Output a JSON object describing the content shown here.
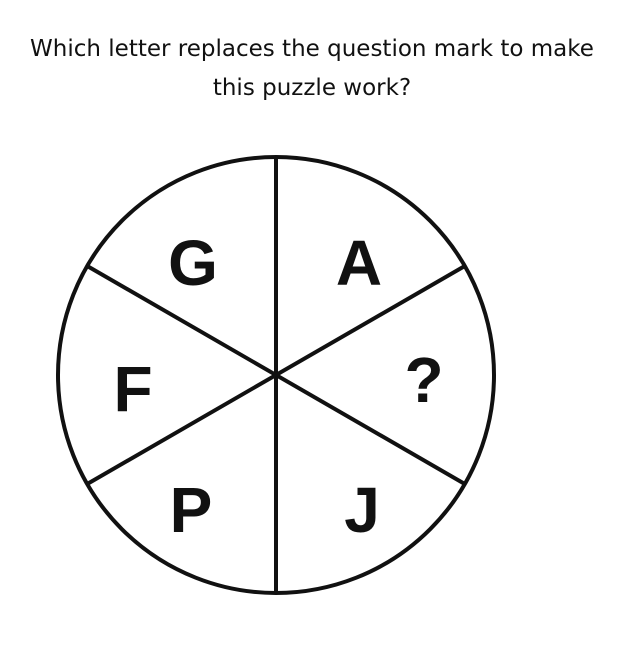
{
  "question": {
    "line1": "Which letter replaces the question mark to make",
    "line2": "this puzzle work?"
  },
  "puzzle": {
    "segments": [
      {
        "id": "top-left",
        "letter": "G"
      },
      {
        "id": "top-right",
        "letter": "A"
      },
      {
        "id": "right",
        "letter": "?"
      },
      {
        "id": "bottom-right",
        "letter": "J"
      },
      {
        "id": "bottom-left",
        "letter": "P"
      },
      {
        "id": "left",
        "letter": "F"
      }
    ],
    "stroke_color": "#111111"
  }
}
